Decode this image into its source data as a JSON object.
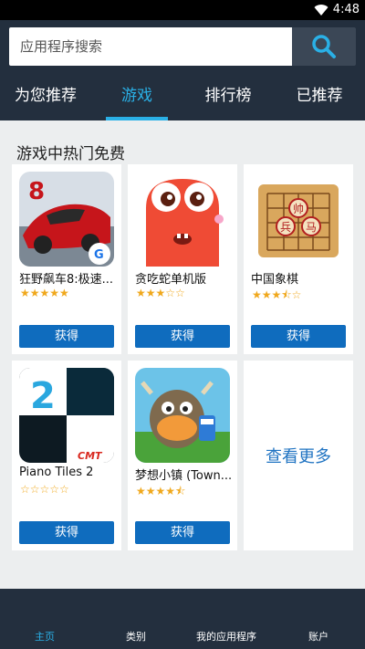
{
  "status_bar": {
    "time": "4:48"
  },
  "search": {
    "placeholder": "应用程序搜索"
  },
  "tabs": [
    {
      "label": "为您推荐",
      "active": false
    },
    {
      "label": "游戏",
      "active": true
    },
    {
      "label": "排行榜",
      "active": false
    },
    {
      "label": "已推荐",
      "active": false
    }
  ],
  "section": {
    "title": "游戏中热门免费"
  },
  "apps": [
    {
      "name": "狂野飙车8:极速...",
      "rating": 5,
      "stars": "★★★★★",
      "button": "获得"
    },
    {
      "name": "贪吃蛇单机版",
      "rating": 3,
      "stars": "★★★☆☆",
      "button": "获得"
    },
    {
      "name": "中国象棋",
      "rating": 3.5,
      "stars": "★★★⯪☆",
      "button": "获得"
    },
    {
      "name": "Piano Tiles 2",
      "rating": 0,
      "stars": "☆☆☆☆☆",
      "button": "获得"
    },
    {
      "name": "梦想小镇 (Town...",
      "rating": 4.5,
      "stars": "★★★★⯪",
      "button": "获得"
    }
  ],
  "more": {
    "label": "查看更多"
  },
  "bottom_nav": [
    {
      "label": "主页",
      "active": true
    },
    {
      "label": "类别",
      "active": false
    },
    {
      "label": "我的应用程序",
      "active": false
    },
    {
      "label": "账户",
      "active": false
    }
  ],
  "colors": {
    "header": "#232f3e",
    "accent": "#2ab0e6",
    "button": "#0f6cbe",
    "star": "#f0a81c",
    "link": "#1f73c2"
  }
}
